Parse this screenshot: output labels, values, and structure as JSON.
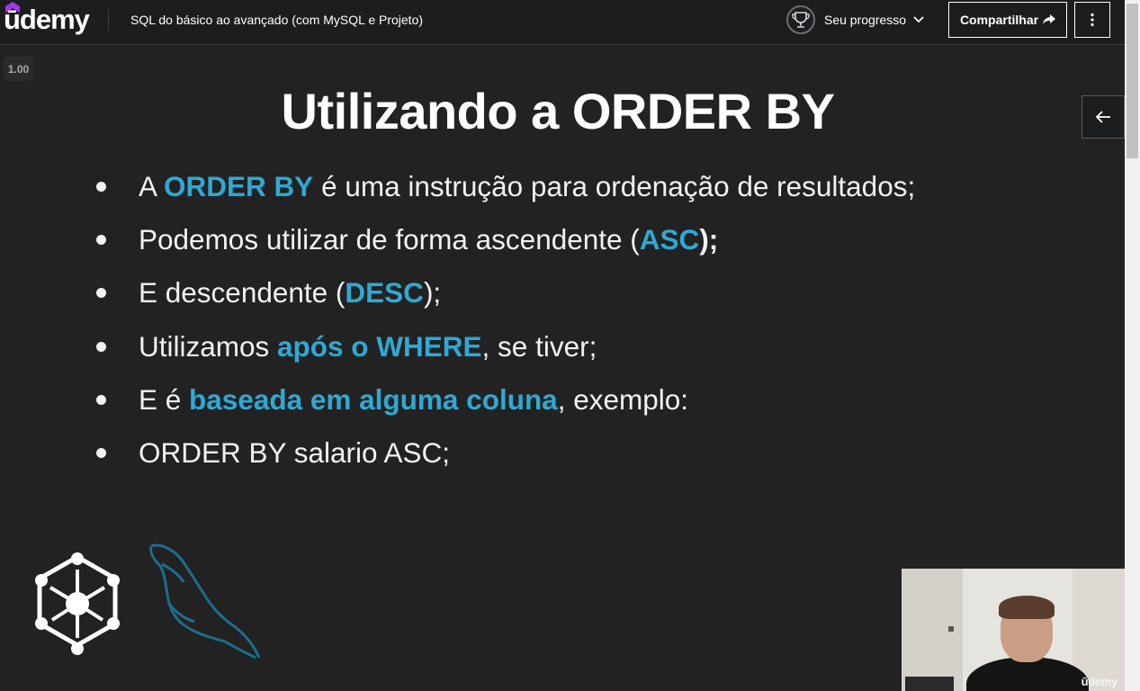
{
  "header": {
    "logo_text": "ūdemy",
    "course_title": "SQL do básico ao avançado (com MySQL e Projeto)",
    "progress_label": "Seu progresso",
    "share_label": "Compartilhar"
  },
  "player": {
    "speed": "1.00",
    "slide": {
      "title": "Utilizando a ORDER BY",
      "bullets": [
        [
          {
            "t": "A "
          },
          {
            "t": "ORDER BY",
            "h": true
          },
          {
            "t": " é uma instrução para ordenação de resultados;"
          }
        ],
        [
          {
            "t": "Podemos utilizar de forma ascendente ("
          },
          {
            "t": "ASC",
            "h": true
          },
          {
            "t": ");",
            "b": true
          }
        ],
        [
          {
            "t": "E descendente ("
          },
          {
            "t": "DESC",
            "h": true
          },
          {
            "t": ");"
          }
        ],
        [
          {
            "t": "Utilizamos "
          },
          {
            "t": "após o WHERE",
            "h": true
          },
          {
            "t": ", se tiver;"
          }
        ],
        [
          {
            "t": "E é "
          },
          {
            "t": "baseada em alguma coluna",
            "h": true
          },
          {
            "t": ", exemplo:"
          }
        ],
        [
          {
            "t": "ORDER BY salario ASC;"
          }
        ]
      ]
    },
    "webcam_watermark": "ūdemy"
  },
  "colors": {
    "accent": "#2ea9d4",
    "background": "#222222",
    "header_bg": "#1c1d1f",
    "brand_purple": "#a435f0"
  },
  "icons": {
    "progress": "trophy-icon",
    "chevron": "chevron-down-icon",
    "share": "share-arrow-icon",
    "more": "more-vertical-icon",
    "back": "arrow-left-icon"
  }
}
